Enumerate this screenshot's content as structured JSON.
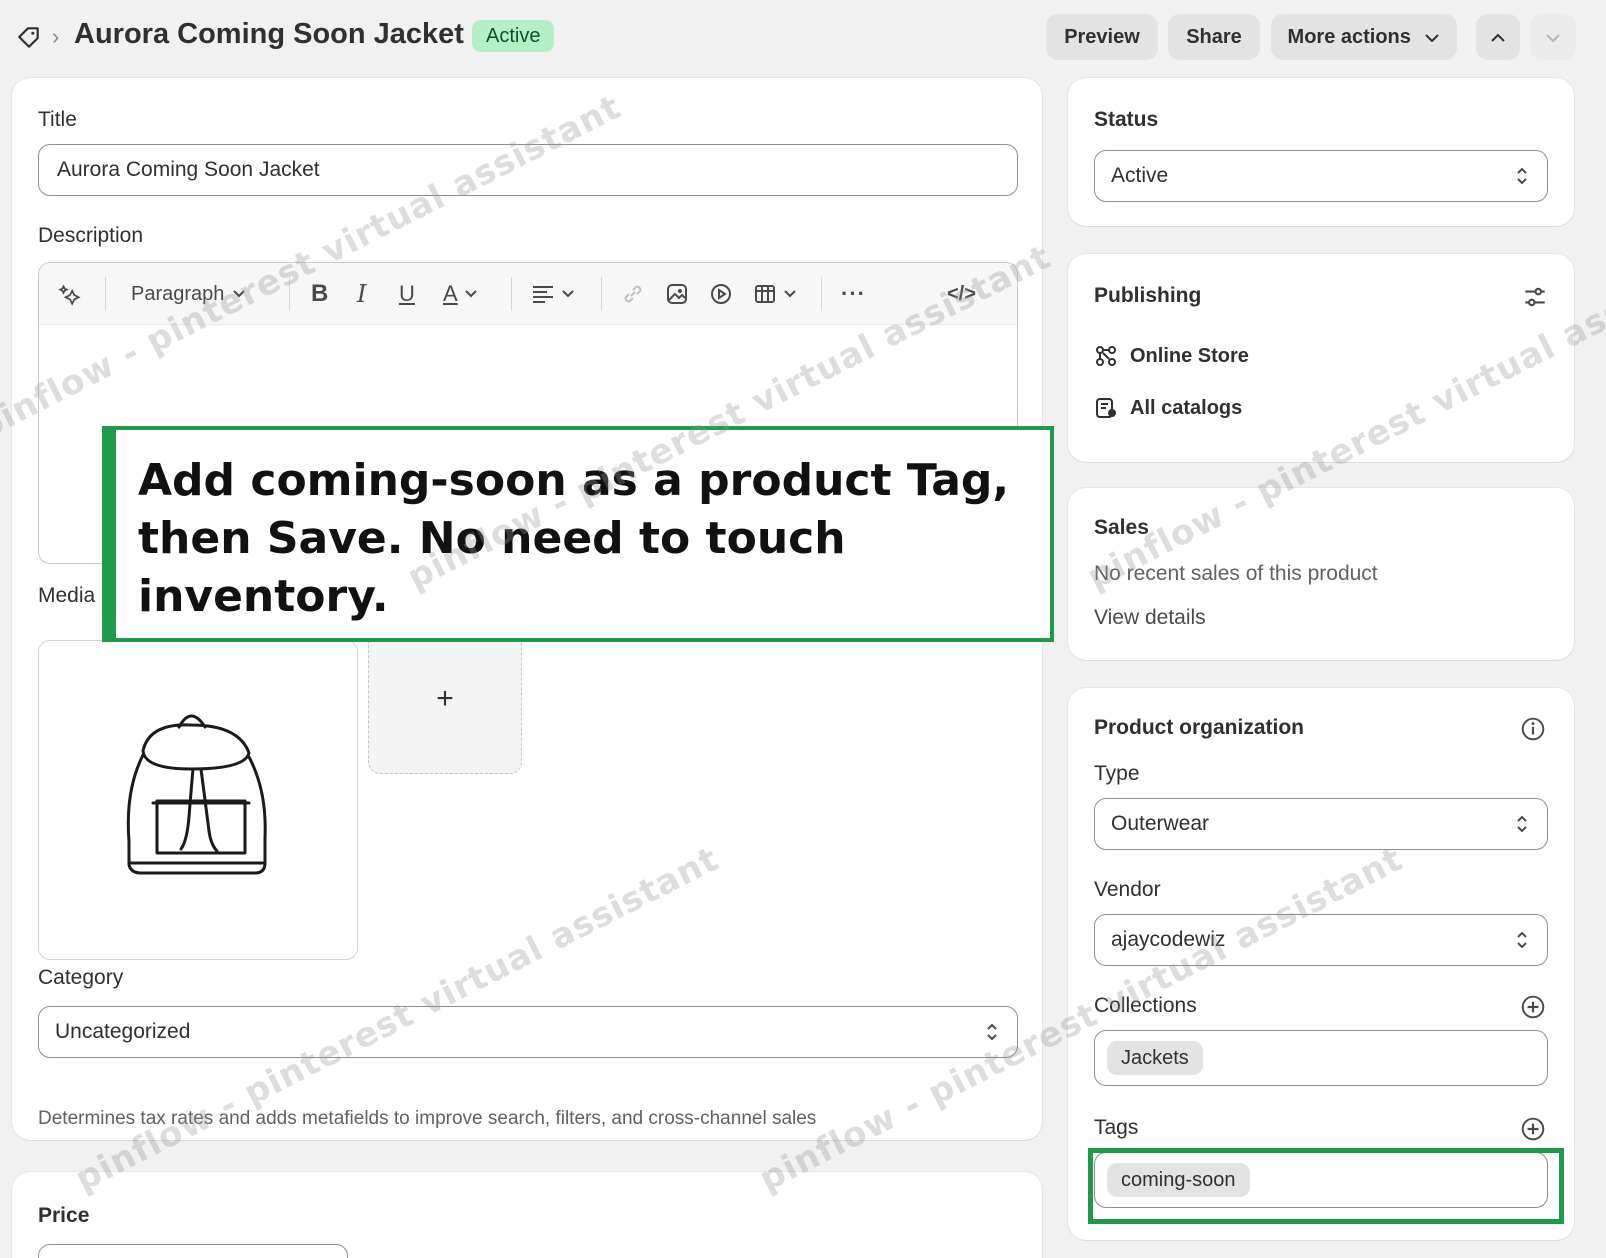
{
  "header": {
    "title": "Aurora Coming Soon Jacket",
    "status_badge": "Active",
    "preview_label": "Preview",
    "share_label": "Share",
    "more_actions_label": "More actions"
  },
  "main": {
    "title_label": "Title",
    "title_value": "Aurora Coming Soon Jacket",
    "description_label": "Description",
    "toolbar": {
      "paragraph_label": "Paragraph"
    },
    "media_label": "Media",
    "media_add": "+",
    "category_label": "Category",
    "category_value": "Uncategorized",
    "category_help": "Determines tax rates and adds metafields to improve search, filters, and cross-channel sales",
    "price_label": "Price"
  },
  "sidebar": {
    "status": {
      "heading": "Status",
      "value": "Active"
    },
    "publishing": {
      "heading": "Publishing",
      "channels": [
        "Online Store",
        "All catalogs"
      ]
    },
    "sales": {
      "heading": "Sales",
      "text": "No recent sales of this product",
      "link": "View details"
    },
    "organization": {
      "heading": "Product organization",
      "type_label": "Type",
      "type_value": "Outerwear",
      "vendor_label": "Vendor",
      "vendor_value": "ajaycodewiz",
      "collections_label": "Collections",
      "collections": [
        "Jackets"
      ],
      "tags_label": "Tags",
      "tags": [
        "coming-soon"
      ]
    }
  },
  "instruction": {
    "text": "Add coming-soon as a product Tag, then Save. No need to touch inventory."
  },
  "watermarks": [
    "pinflow - pinterest virtual assistant",
    "pinflow - pinterest virtual assistant",
    "pinflow - pinterest virtual assistant",
    "pinflow - pinterest virtual assistant",
    "pinflow - pinterest virtual assistant"
  ],
  "colors": {
    "accent_green": "#1e9b4a",
    "badge_bg": "#b4f0c6",
    "badge_text": "#0c5132"
  }
}
